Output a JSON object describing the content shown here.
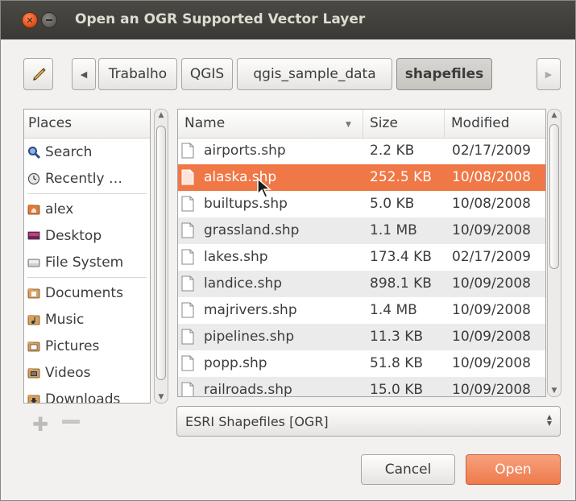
{
  "window": {
    "title": "Open an OGR Supported Vector Layer"
  },
  "icons": {
    "close": "close-icon",
    "minimize": "minimize-icon",
    "edit": "pencil-icon"
  },
  "breadcrumb": [
    "Trabalho",
    "QGIS",
    "qgis_sample_data",
    "shapefiles"
  ],
  "places": {
    "header": "Places",
    "groups": [
      [
        {
          "label": "Search",
          "icon": "search-icon"
        },
        {
          "label": "Recently …",
          "icon": "recent-icon"
        }
      ],
      [
        {
          "label": "alex",
          "icon": "home-folder-icon"
        },
        {
          "label": "Desktop",
          "icon": "desktop-icon"
        },
        {
          "label": "File System",
          "icon": "drive-icon"
        }
      ],
      [
        {
          "label": "Documents",
          "icon": "documents-folder-icon"
        },
        {
          "label": "Music",
          "icon": "music-folder-icon"
        },
        {
          "label": "Pictures",
          "icon": "pictures-folder-icon"
        },
        {
          "label": "Videos",
          "icon": "videos-folder-icon"
        },
        {
          "label": "Downloads",
          "icon": "downloads-folder-icon"
        }
      ]
    ]
  },
  "files": {
    "columns": [
      "Name",
      "Size",
      "Modified"
    ],
    "rows": [
      {
        "name": "airports.shp",
        "size": "2.2 KB",
        "modified": "02/17/2009"
      },
      {
        "name": "alaska.shp",
        "size": "252.5 KB",
        "modified": "10/08/2008",
        "selected": true
      },
      {
        "name": "builtups.shp",
        "size": "5.0 KB",
        "modified": "10/08/2008"
      },
      {
        "name": "grassland.shp",
        "size": "1.1 MB",
        "modified": "10/09/2008"
      },
      {
        "name": "lakes.shp",
        "size": "173.4 KB",
        "modified": "02/17/2009"
      },
      {
        "name": "landice.shp",
        "size": "898.1 KB",
        "modified": "10/09/2008"
      },
      {
        "name": "majrivers.shp",
        "size": "1.4 MB",
        "modified": "10/09/2008"
      },
      {
        "name": "pipelines.shp",
        "size": "11.3 KB",
        "modified": "10/09/2008"
      },
      {
        "name": "popp.shp",
        "size": "51.8 KB",
        "modified": "10/09/2008"
      },
      {
        "name": "railroads.shp",
        "size": "15.0 KB",
        "modified": "10/09/2008"
      }
    ]
  },
  "filter": {
    "value": "ESRI Shapefiles [OGR]"
  },
  "buttons": {
    "cancel": "Cancel",
    "open": "Open"
  },
  "colors": {
    "selection": "#f07746",
    "accent_button": "#ee7a4c",
    "titlebar": "#3c3b37"
  }
}
